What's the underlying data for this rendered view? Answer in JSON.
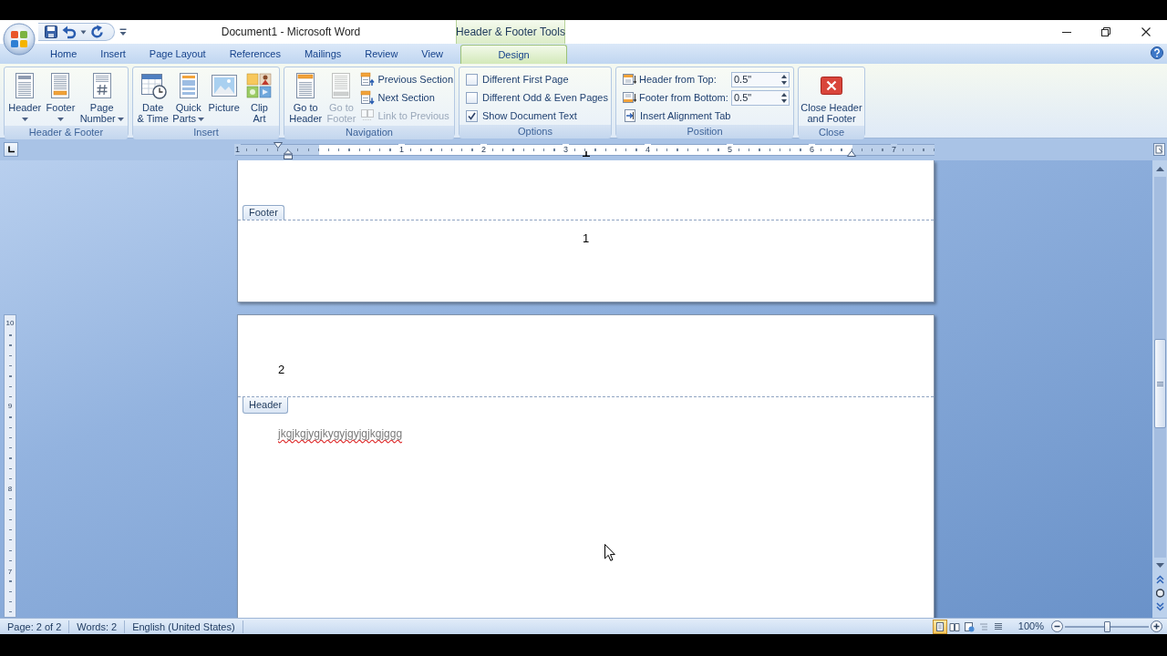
{
  "window": {
    "title": "Document1 - Microsoft Word",
    "context_label": "Header & Footer Tools"
  },
  "tabs": [
    {
      "label": "Home",
      "selected": false
    },
    {
      "label": "Insert",
      "selected": false
    },
    {
      "label": "Page Layout",
      "selected": false
    },
    {
      "label": "References",
      "selected": false
    },
    {
      "label": "Mailings",
      "selected": false
    },
    {
      "label": "Review",
      "selected": false
    },
    {
      "label": "View",
      "selected": false
    },
    {
      "label": "Design",
      "selected": true
    }
  ],
  "ribbon": {
    "groups": [
      {
        "title": "Header & Footer",
        "items": [
          {
            "kind": "large",
            "lines": [
              "Header"
            ],
            "dropdown": true,
            "disabled": false
          },
          {
            "kind": "large",
            "lines": [
              "Footer"
            ],
            "dropdown": true,
            "disabled": false
          },
          {
            "kind": "large",
            "lines": [
              "Page",
              "Number"
            ],
            "dropdown": true,
            "disabled": false
          }
        ]
      },
      {
        "title": "Insert",
        "items": [
          {
            "kind": "large",
            "lines": [
              "Date",
              "& Time"
            ],
            "dropdown": false,
            "disabled": false
          },
          {
            "kind": "large",
            "lines": [
              "Quick",
              "Parts"
            ],
            "dropdown": true,
            "disabled": false
          },
          {
            "kind": "large",
            "lines": [
              "Picture"
            ],
            "dropdown": false,
            "disabled": false
          },
          {
            "kind": "large",
            "lines": [
              "Clip",
              "Art"
            ],
            "dropdown": false,
            "disabled": false
          }
        ]
      },
      {
        "title": "Navigation",
        "items": [
          {
            "kind": "large",
            "lines": [
              "Go to",
              "Header"
            ],
            "dropdown": false,
            "disabled": false
          },
          {
            "kind": "large",
            "lines": [
              "Go to",
              "Footer"
            ],
            "dropdown": false,
            "disabled": true
          },
          {
            "kind": "small",
            "label": "Previous Section",
            "disabled": false
          },
          {
            "kind": "small",
            "label": "Next Section",
            "disabled": false
          },
          {
            "kind": "small",
            "label": "Link to Previous",
            "disabled": true
          }
        ]
      },
      {
        "title": "Options",
        "items": [
          {
            "kind": "checkbox",
            "label": "Different First Page",
            "checked": false
          },
          {
            "kind": "checkbox",
            "label": "Different Odd & Even Pages",
            "checked": false
          },
          {
            "kind": "checkbox",
            "label": "Show Document Text",
            "checked": true
          }
        ]
      },
      {
        "title": "Position",
        "items": [
          {
            "kind": "spinner",
            "label": "Header from Top:",
            "value": "0.5\""
          },
          {
            "kind": "spinner",
            "label": "Footer from Bottom:",
            "value": "0.5\""
          },
          {
            "kind": "small",
            "label": "Insert Alignment Tab",
            "disabled": false
          }
        ]
      },
      {
        "title": "Close",
        "items": [
          {
            "kind": "large",
            "lines": [
              "Close Header",
              "and Footer"
            ],
            "dropdown": false,
            "disabled": false
          }
        ]
      }
    ]
  },
  "ruler": {
    "numbers": [
      "1",
      "1",
      "2",
      "3",
      "4",
      "5",
      "6",
      "7"
    ]
  },
  "vertical_ruler": {
    "numbers": [
      "10",
      "9",
      "8",
      "7"
    ]
  },
  "pages": [
    {
      "footer": {
        "label": "Footer",
        "text": "1"
      }
    },
    {
      "header": {
        "label": "Header",
        "text": "2"
      },
      "body": [
        {
          "text": "jkgjkgjygjkygyjgyjgjkgjggg",
          "misspelled": true
        }
      ]
    }
  ],
  "status_bar": {
    "items": [
      "Page: 2 of 2",
      "Words: 2",
      "English (United States)"
    ],
    "views": [
      {
        "selected": true
      },
      {
        "selected": false
      },
      {
        "selected": false
      },
      {
        "selected": false
      },
      {
        "selected": false
      }
    ],
    "zoom": {
      "reading": "100%",
      "level": 0.5
    }
  }
}
